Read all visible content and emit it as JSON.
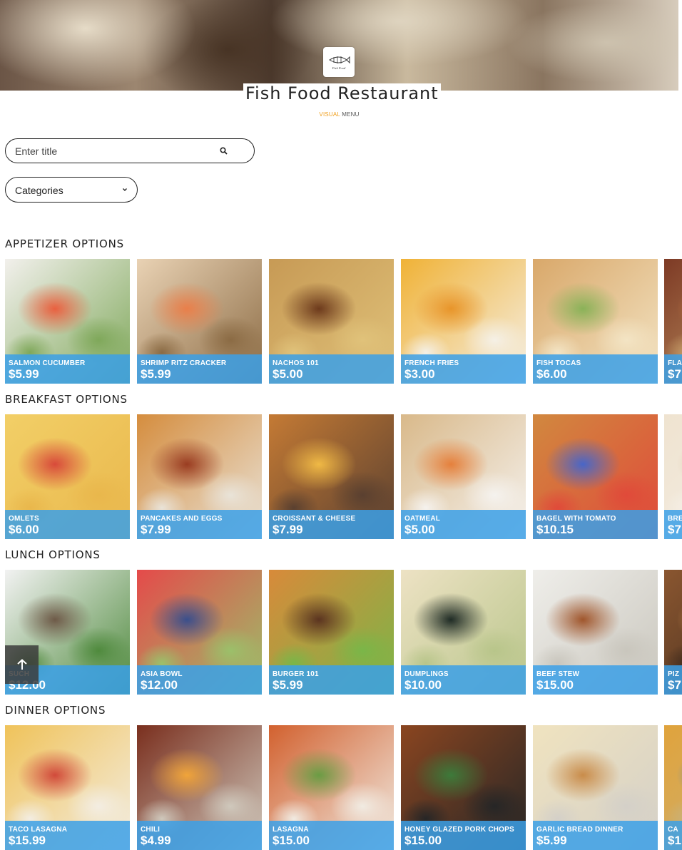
{
  "header": {
    "title": "Fish Food Restaurant",
    "subtitle_accent": "VISUAL",
    "subtitle_rest": " MENU",
    "logo_text": "Fish Food"
  },
  "search": {
    "placeholder": "Enter title",
    "value": ""
  },
  "categories": {
    "selected": "Categories"
  },
  "colors": {
    "accent": "#f0a020",
    "price_band": "#3ba0e8"
  },
  "sections": [
    {
      "title": "APPETIZER OPTIONS",
      "items": [
        {
          "name": "SALMON CUCUMBER",
          "price": "$5.99",
          "palette": [
            "#f2f0ec",
            "#e9603f",
            "#7fa85a"
          ]
        },
        {
          "name": "SHRIMP RITZ CRACKER",
          "price": "$5.99",
          "palette": [
            "#e9d2b4",
            "#e97f4a",
            "#8b6b44"
          ]
        },
        {
          "name": "NACHOS 101",
          "price": "$5.00",
          "palette": [
            "#c79a55",
            "#6d3a1c",
            "#e0c27a"
          ]
        },
        {
          "name": "FRENCH FRIES",
          "price": "$3.00",
          "palette": [
            "#f0b236",
            "#e8952a",
            "#f5f0e6"
          ]
        },
        {
          "name": "FISH TOCAS",
          "price": "$6.00",
          "palette": [
            "#d9a86a",
            "#8ab258",
            "#f3e4c4"
          ]
        },
        {
          "name": "FLA",
          "price": "$7",
          "palette": [
            "#7d3a25",
            "#d0783d",
            "#c9a26c"
          ]
        }
      ]
    },
    {
      "title": "BREAKFAST OPTIONS",
      "items": [
        {
          "name": "OMLETS",
          "price": "$6.00",
          "palette": [
            "#f2cf67",
            "#d84a3a",
            "#e9b74c"
          ]
        },
        {
          "name": "PANCAKES AND EGGS",
          "price": "$7.99",
          "palette": [
            "#d58d3e",
            "#9a3c21",
            "#e9e3d8"
          ]
        },
        {
          "name": "CROISSANT & CHEESE",
          "price": "$7.99",
          "palette": [
            "#c47a34",
            "#f0b945",
            "#5a4030"
          ]
        },
        {
          "name": "OATMEAL",
          "price": "$5.00",
          "palette": [
            "#d9b98a",
            "#e5803c",
            "#f5f2ee"
          ]
        },
        {
          "name": "BAGEL WITH TOMATO",
          "price": "$10.15",
          "palette": [
            "#d1883f",
            "#4866c8",
            "#e04a3a"
          ]
        },
        {
          "name": "BRE",
          "price": "$7",
          "palette": [
            "#efe3d0",
            "#d8c3a2",
            "#f5efe6"
          ]
        }
      ]
    },
    {
      "title": "LUNCH OPTIONS",
      "items": [
        {
          "name": "SUCH",
          "price": "$12.00",
          "palette": [
            "#f2f2f2",
            "#6e5a48",
            "#4f8a3d"
          ]
        },
        {
          "name": "ASIA BOWL",
          "price": "$12.00",
          "palette": [
            "#e54a4a",
            "#3a4f8c",
            "#9bc06a"
          ]
        },
        {
          "name": "BURGER 101",
          "price": "$5.99",
          "palette": [
            "#d88a3a",
            "#5b3420",
            "#7ab648"
          ]
        },
        {
          "name": "DUMPLINGS",
          "price": "$10.00",
          "palette": [
            "#ede2c4",
            "#1f2b25",
            "#b8c58a"
          ]
        },
        {
          "name": "BEEF STEW",
          "price": "$15.00",
          "palette": [
            "#efeeea",
            "#a0562c",
            "#c9c6bd"
          ]
        },
        {
          "name": "PIZ",
          "price": "$7",
          "palette": [
            "#8a5630",
            "#d69a55",
            "#3e2a1c"
          ]
        }
      ]
    },
    {
      "title": "DINNER OPTIONS",
      "items": [
        {
          "name": "TACO LASAGNA",
          "price": "$15.99",
          "palette": [
            "#f0c35a",
            "#d14a3a",
            "#f3ede2"
          ]
        },
        {
          "name": "CHILI",
          "price": "$4.99",
          "palette": [
            "#7a2f1e",
            "#f0a43a",
            "#cfc8bc"
          ]
        },
        {
          "name": "LASAGNA",
          "price": "$15.00",
          "palette": [
            "#d2612f",
            "#6a9c44",
            "#f1ebe2"
          ]
        },
        {
          "name": "HONEY GLAZED PORK CHOPS",
          "price": "$15.00",
          "palette": [
            "#8a4520",
            "#3d7a3a",
            "#262626"
          ]
        },
        {
          "name": "GARLIC BREAD DINNER",
          "price": "$5.99",
          "palette": [
            "#f0e3bf",
            "#c98c4a",
            "#d4d0c8"
          ]
        },
        {
          "name": "CA",
          "price": "$1",
          "palette": [
            "#e0a33c",
            "#3a7dc8",
            "#c9b27a"
          ]
        }
      ]
    }
  ]
}
